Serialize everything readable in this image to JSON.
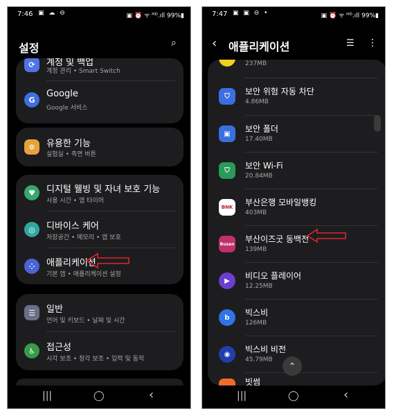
{
  "left": {
    "status": {
      "time": "7:46",
      "icons": "▣ ☁ ⊖",
      "right": "▣ ⏰ ᯤ ᴴᴰ.ıll 99%▮"
    },
    "title": "설정",
    "groups": [
      {
        "items": [
          {
            "label": "계정 및 백업",
            "sub": "계정 관리 • Smart Switch",
            "icon": "sync-icon",
            "color": "#4d73e6"
          },
          {
            "label": "Google",
            "sub": "Google 서비스",
            "icon": "google-icon",
            "color": "#3d6fe0"
          }
        ]
      },
      {
        "items": [
          {
            "label": "유용한 기능",
            "sub": "실험실 • 측면 버튼",
            "icon": "puzzle-icon",
            "color": "#e6a33a"
          }
        ]
      },
      {
        "items": [
          {
            "label": "디지털 웰빙 및 자녀 보호 기능",
            "sub": "사용 시간 • 앱 타이머",
            "icon": "wellbeing-icon",
            "color": "#36a86a"
          },
          {
            "label": "디바이스 케어",
            "sub": "저장공간 • 메모리 • 앱 보호",
            "icon": "device-care-icon",
            "color": "#2fa8a0"
          },
          {
            "label": "애플리케이션",
            "sub": "기본 앱 • 애플리케이션 설정",
            "icon": "apps-icon",
            "color": "#4a63d6"
          }
        ]
      },
      {
        "items": [
          {
            "label": "일반",
            "sub": "언어 및 키보드 • 날짜 및 시간",
            "icon": "sliders-icon",
            "color": "#6a6f86"
          },
          {
            "label": "접근성",
            "sub": "시각 보조 • 청각 보조 • 입력 및 동작",
            "icon": "accessibility-icon",
            "color": "#3a9a4a"
          }
        ]
      }
    ],
    "accent_arrow": "#e0252f"
  },
  "right": {
    "status": {
      "time": "7:47",
      "icons": "▣ ▣ ⊖ •",
      "right": "▣ ⏰ ᯤ ᴴᴰ.ıll 99%▮"
    },
    "title": "애플리케이션",
    "apps": [
      {
        "name": "",
        "size": "237MB",
        "icon": "partial-app-icon",
        "color": "#f0d020",
        "glyph": ""
      },
      {
        "name": "보안 위험 자동 차단",
        "size": "4.86MB",
        "icon": "shield-icon",
        "color": "#3a6fe0",
        "glyph": "⛉"
      },
      {
        "name": "보안 폴더",
        "size": "17.40MB",
        "icon": "secure-folder-icon",
        "color": "#3a6fe0",
        "glyph": "▣"
      },
      {
        "name": "보안 Wi-Fi",
        "size": "20.84MB",
        "icon": "wifi-shield-icon",
        "color": "#2a9a5a",
        "glyph": "⛉"
      },
      {
        "name": "부산은행 모바일뱅킹",
        "size": "403MB",
        "icon": "bnk-icon",
        "color": "#ffffff",
        "glyph": "BNK"
      },
      {
        "name": "부산이즈굿 동백전",
        "size": "139MB",
        "icon": "busan-icon",
        "color": "#c0306a",
        "glyph": "Busan"
      },
      {
        "name": "비디오 플레이어",
        "size": "12.25MB",
        "icon": "play-icon",
        "color": "#6a3fd0",
        "glyph": "▶"
      },
      {
        "name": "빅스비",
        "size": "126MB",
        "icon": "bixby-icon",
        "color": "#2f74e8",
        "glyph": "b"
      },
      {
        "name": "빅스비 비전",
        "size": "45.79MB",
        "icon": "eye-icon",
        "color": "#1f3fb0",
        "glyph": "◉"
      },
      {
        "name": "빗썸",
        "size": "",
        "icon": "bithumb-icon",
        "color": "#f06a2a",
        "glyph": ""
      }
    ]
  },
  "nav": {
    "recents": "|||",
    "home": "◯",
    "back": "‹"
  }
}
